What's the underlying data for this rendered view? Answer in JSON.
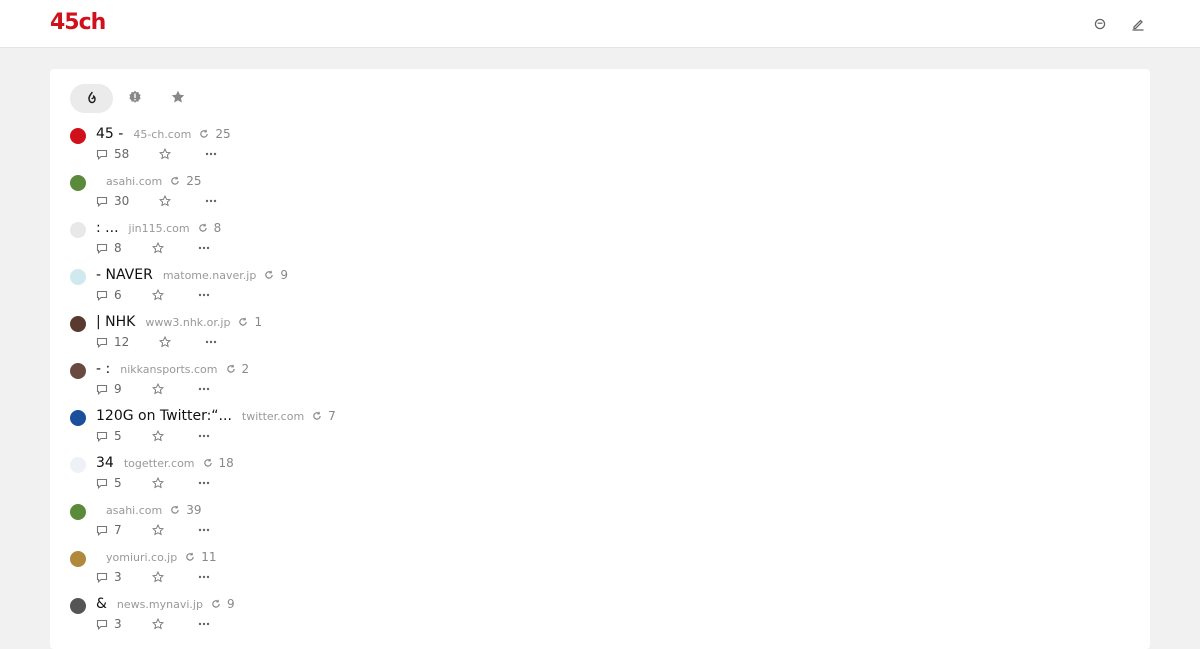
{
  "header": {
    "logo": "45ch",
    "icons": [
      "smile-icon",
      "edit-icon"
    ]
  },
  "tabs": [
    {
      "name": "popular",
      "icon": "flame-icon",
      "active": true
    },
    {
      "name": "new",
      "icon": "badge-icon",
      "active": false
    },
    {
      "name": "favorites",
      "icon": "star-icon",
      "active": false
    }
  ],
  "items": [
    {
      "title": "45 -",
      "domain": "45-ch.com",
      "refresh": "25",
      "comments": "58",
      "avatar_color": "#d0111b"
    },
    {
      "title": "",
      "domain": "asahi.com",
      "refresh": "25",
      "comments": "30",
      "avatar_color": "#5b8a3a"
    },
    {
      "title": ": ...",
      "domain": "jin115.com",
      "refresh": "8",
      "comments": "8",
      "avatar_color": "#e8e8e8"
    },
    {
      "title": "- NAVER",
      "domain": "matome.naver.jp",
      "refresh": "9",
      "comments": "6",
      "avatar_color": "#cfe9ee"
    },
    {
      "title": "| NHK",
      "domain": "www3.nhk.or.jp",
      "refresh": "1",
      "comments": "12",
      "avatar_color": "#5a3a30"
    },
    {
      "title": "- :",
      "domain": "nikkansports.com",
      "refresh": "2",
      "comments": "9",
      "avatar_color": "#6a4a40"
    },
    {
      "title": "120G on Twitter:“...",
      "domain": "twitter.com",
      "refresh": "7",
      "comments": "5",
      "avatar_color": "#1b4f9c"
    },
    {
      "title": "34",
      "domain": "togetter.com",
      "refresh": "18",
      "comments": "5",
      "avatar_color": "#eef2f6"
    },
    {
      "title": "",
      "domain": "asahi.com",
      "refresh": "39",
      "comments": "7",
      "avatar_color": "#5b8a3a"
    },
    {
      "title": "",
      "domain": "yomiuri.co.jp",
      "refresh": "11",
      "comments": "3",
      "avatar_color": "#b08a3a"
    },
    {
      "title": "&",
      "domain": "news.mynavi.jp",
      "refresh": "9",
      "comments": "3",
      "avatar_color": "#555555"
    }
  ]
}
